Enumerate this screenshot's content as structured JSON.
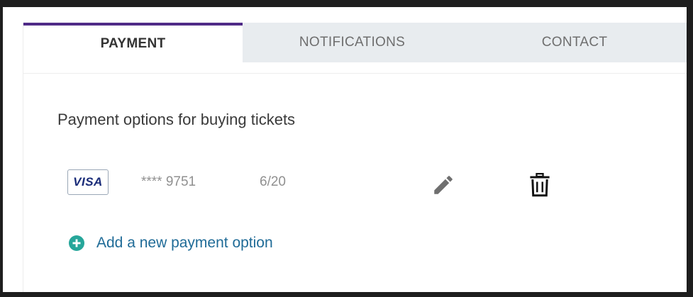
{
  "tabs": {
    "payment": "PAYMENT",
    "notifications": "NOTIFICATIONS",
    "contact": "CONTACT",
    "active": "PAYMENT"
  },
  "payment_section": {
    "title": "Payment options for buying tickets",
    "cards": [
      {
        "brand": "VISA",
        "number": "**** 9751",
        "expiry": "6/20",
        "edit_icon": "pencil-icon",
        "delete_icon": "trash-icon"
      }
    ],
    "add_option_label": "Add a new payment option",
    "add_icon": "plus-circle-icon"
  },
  "colors": {
    "accent": "#4f2a87",
    "link": "#1f6b97",
    "add_icon": "#26a69a",
    "tab_inactive_bg": "#e8ecef",
    "visa_text": "#1a2c79"
  }
}
